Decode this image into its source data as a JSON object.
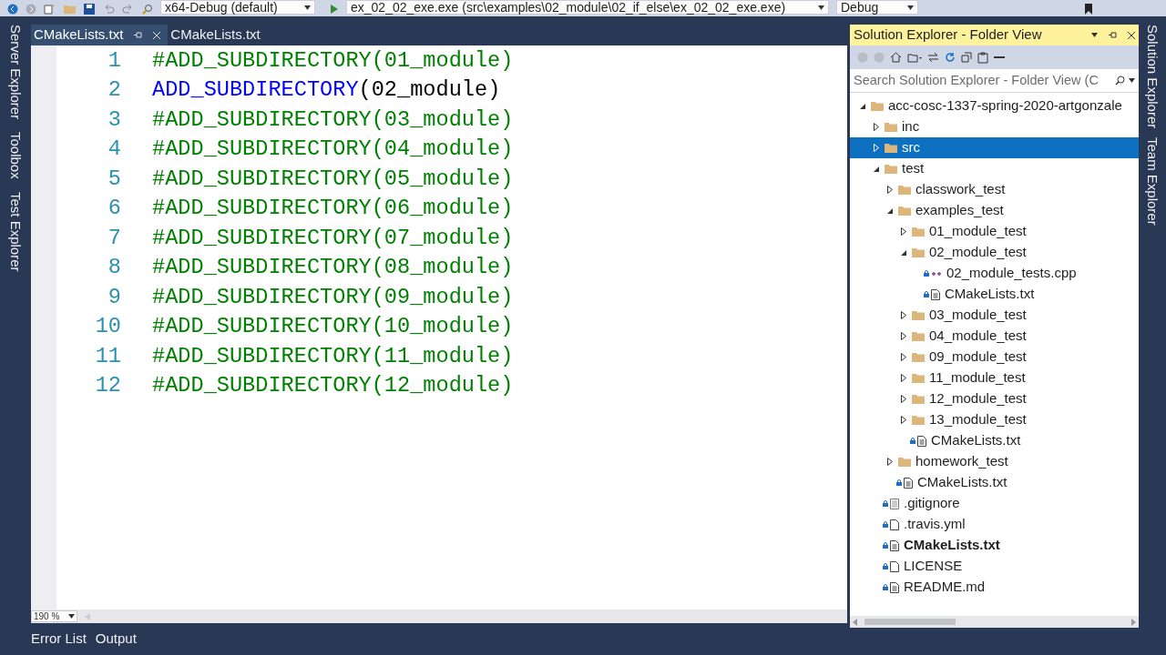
{
  "toolbar": {
    "configuration": "x64-Debug (default)",
    "startup_item": "ex_02_02_exe.exe (src\\examples\\02_module\\02_if_else\\ex_02_02_exe.exe)",
    "build_type": "Debug"
  },
  "left_side_tabs": [
    "Server Explorer",
    "Toolbox",
    "Test Explorer"
  ],
  "editor_tabs": [
    {
      "label": "CMakeLists.txt",
      "selected": true
    },
    {
      "label": "CMakeLists.txt",
      "selected": false
    }
  ],
  "code_lines": [
    {
      "number": "1",
      "kind": "comment",
      "text": "#ADD_SUBDIRECTORY(01_module)"
    },
    {
      "number": "2",
      "kind": "command",
      "keyword": "ADD_SUBDIRECTORY",
      "text": "(02_module)"
    },
    {
      "number": "3",
      "kind": "comment",
      "text": "#ADD_SUBDIRECTORY(03_module)"
    },
    {
      "number": "4",
      "kind": "comment",
      "text": "#ADD_SUBDIRECTORY(04_module)"
    },
    {
      "number": "5",
      "kind": "comment",
      "text": "#ADD_SUBDIRECTORY(05_module)"
    },
    {
      "number": "6",
      "kind": "comment",
      "text": "#ADD_SUBDIRECTORY(06_module)"
    },
    {
      "number": "7",
      "kind": "comment",
      "text": "#ADD_SUBDIRECTORY(07_module)"
    },
    {
      "number": "8",
      "kind": "comment",
      "text": "#ADD_SUBDIRECTORY(08_module)"
    },
    {
      "number": "9",
      "kind": "comment",
      "text": "#ADD_SUBDIRECTORY(09_module)"
    },
    {
      "number": "10",
      "kind": "comment",
      "text": "#ADD_SUBDIRECTORY(10_module)"
    },
    {
      "number": "11",
      "kind": "comment",
      "text": "#ADD_SUBDIRECTORY(11_module)"
    },
    {
      "number": "12",
      "kind": "comment",
      "text": "#ADD_SUBDIRECTORY(12_module)"
    }
  ],
  "zoom": "190 %",
  "solution_explorer": {
    "title": "Solution Explorer - Folder View",
    "search": {
      "placeholder": "Search Solution Explorer - Folder View (C"
    },
    "tree": [
      {
        "label": "acc-cosc-1337-spring-2020-artgonzale",
        "kind": "folder",
        "expanded": true,
        "selected": false,
        "bold": false,
        "children": [
          {
            "label": "inc",
            "kind": "folder",
            "expanded": false,
            "selected": false,
            "bold": false
          },
          {
            "label": "src",
            "kind": "folder",
            "expanded": false,
            "selected": true,
            "bold": false
          },
          {
            "label": "test",
            "kind": "folder",
            "expanded": true,
            "selected": false,
            "bold": false,
            "children": [
              {
                "label": "classwork_test",
                "kind": "folder",
                "expanded": false,
                "selected": false,
                "bold": false
              },
              {
                "label": "examples_test",
                "kind": "folder",
                "expanded": true,
                "selected": false,
                "bold": false,
                "children": [
                  {
                    "label": "01_module_test",
                    "kind": "folder",
                    "expanded": false,
                    "selected": false,
                    "bold": false
                  },
                  {
                    "label": "02_module_test",
                    "kind": "folder",
                    "expanded": true,
                    "selected": false,
                    "bold": false,
                    "children": [
                      {
                        "label": "02_module_tests.cpp",
                        "kind": "cpp",
                        "selected": false,
                        "bold": false
                      },
                      {
                        "label": "CMakeLists.txt",
                        "kind": "document",
                        "selected": false,
                        "bold": false
                      }
                    ]
                  },
                  {
                    "label": "03_module_test",
                    "kind": "folder",
                    "expanded": false,
                    "selected": false,
                    "bold": false
                  },
                  {
                    "label": "04_module_test",
                    "kind": "folder",
                    "expanded": false,
                    "selected": false,
                    "bold": false
                  },
                  {
                    "label": "09_module_test",
                    "kind": "folder",
                    "expanded": false,
                    "selected": false,
                    "bold": false
                  },
                  {
                    "label": "11_module_test",
                    "kind": "folder",
                    "expanded": false,
                    "selected": false,
                    "bold": false
                  },
                  {
                    "label": "12_module_test",
                    "kind": "folder",
                    "expanded": false,
                    "selected": false,
                    "bold": false
                  },
                  {
                    "label": "13_module_test",
                    "kind": "folder",
                    "expanded": false,
                    "selected": false,
                    "bold": false
                  },
                  {
                    "label": "CMakeLists.txt",
                    "kind": "document",
                    "selected": false,
                    "bold": false
                  }
                ]
              },
              {
                "label": "homework_test",
                "kind": "folder",
                "expanded": false,
                "selected": false,
                "bold": false
              },
              {
                "label": "CMakeLists.txt",
                "kind": "document",
                "selected": false,
                "bold": false
              }
            ]
          },
          {
            "label": ".gitignore",
            "kind": "text",
            "selected": false,
            "bold": false
          },
          {
            "label": ".travis.yml",
            "kind": "blank",
            "selected": false,
            "bold": false
          },
          {
            "label": "CMakeLists.txt",
            "kind": "document",
            "selected": false,
            "bold": true
          },
          {
            "label": "LICENSE",
            "kind": "blank",
            "selected": false,
            "bold": false
          },
          {
            "label": "README.md",
            "kind": "document",
            "selected": false,
            "bold": false
          }
        ]
      }
    ]
  },
  "right_side_tabs": [
    "Solution Explorer",
    "Team Explorer"
  ],
  "bottom_tabs": [
    "Error List",
    "Output"
  ]
}
